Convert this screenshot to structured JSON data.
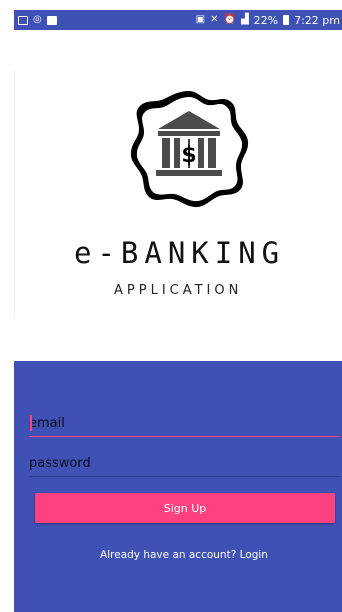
{
  "status_bar": {
    "battery": "22%",
    "time": "7:22 pm"
  },
  "brand": {
    "title": "e-BANKING",
    "subtitle": "APPLICATION",
    "logo_icon": "bank-dollar-seal-icon"
  },
  "form": {
    "email_placeholder": "email",
    "password_placeholder": "password",
    "signup_label": "Sign Up",
    "login_link": "Already have an account? Login"
  },
  "colors": {
    "primary": "#3f51b5",
    "accent": "#ff4081",
    "background": "#ffffff"
  }
}
